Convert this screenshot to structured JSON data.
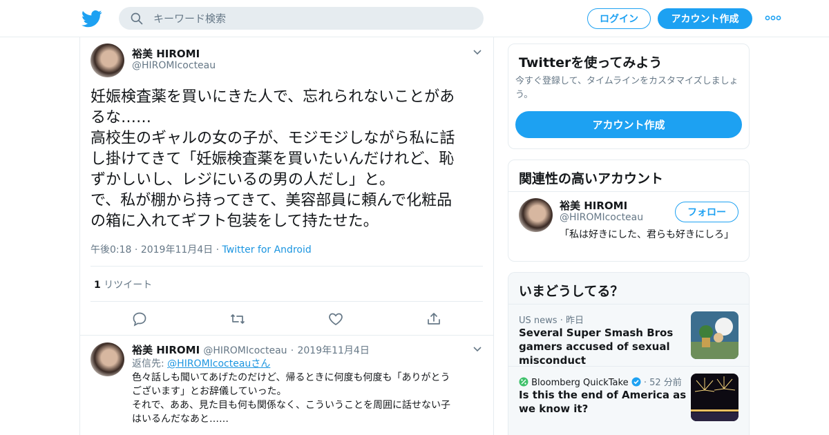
{
  "topbar": {
    "search_placeholder": "キーワード検索",
    "login_label": "ログイン",
    "signup_label": "アカウント作成"
  },
  "tweet": {
    "author_name": "裕美 HIROMI",
    "author_handle": "@HIROMIcocteau",
    "text_lines": [
      "妊娠検査薬を買いにきた人で、忘れられないことがあ",
      "るな……",
      "高校生のギャルの女の子が、モジモジしながら私に話",
      "し掛けてきて「妊娠検査薬を買いたいんだけれど、恥",
      "ずかしいし、レジにいるの男の人だし」と。",
      "で、私が棚から持ってきて、美容部員に頼んで化粧品",
      "の箱に入れてギフト包装をして持たせた。"
    ],
    "time": "午後0:18",
    "date": "2019年11月4日",
    "client": "Twitter for Android",
    "retweet_count": "1",
    "retweet_label": "リツイート"
  },
  "reply": {
    "author_name": "裕美 HIROMI",
    "author_handle": "@HIROMIcocteau",
    "date": "2019年11月4日",
    "reply_to_label": "返信先:",
    "reply_to_handle": "@HIROMIcocteauさん",
    "text_lines": [
      "色々話しも聞いてあげたのだけど、帰るときに何度も何度も「ありがとう",
      "ございます」とお辞儀していった。",
      "それで、ああ、見た目も何も関係なく、こういうことを周囲に話せない子",
      "はいるんだなあと……"
    ]
  },
  "signup_card": {
    "title": "Twitterを使ってみよう",
    "description": "今すぐ登録して、タイムラインをカスタマイズしましょう。",
    "button_label": "アカウント作成"
  },
  "related_card": {
    "title": "関連性の高いアカウント",
    "name": "裕美 HIROMI",
    "handle": "@HIROMIcocteau",
    "follow_label": "フォロー",
    "bio": "「私は好きにした、君らも好きにしろ」"
  },
  "trends_card": {
    "title": "いまどうしてる？",
    "items": [
      {
        "source": "US news",
        "time": "昨日",
        "headline": "Several Super Smash Bros gamers accused of sexual misconduct"
      },
      {
        "source": "Bloomberg QuickTake",
        "time": "52 分前",
        "headline": "Is this the end of America as we know it?"
      }
    ]
  },
  "colors": {
    "accent": "#1da1f2",
    "link": "#1b95e0",
    "muted": "#657786",
    "border": "#e6ecf0"
  }
}
